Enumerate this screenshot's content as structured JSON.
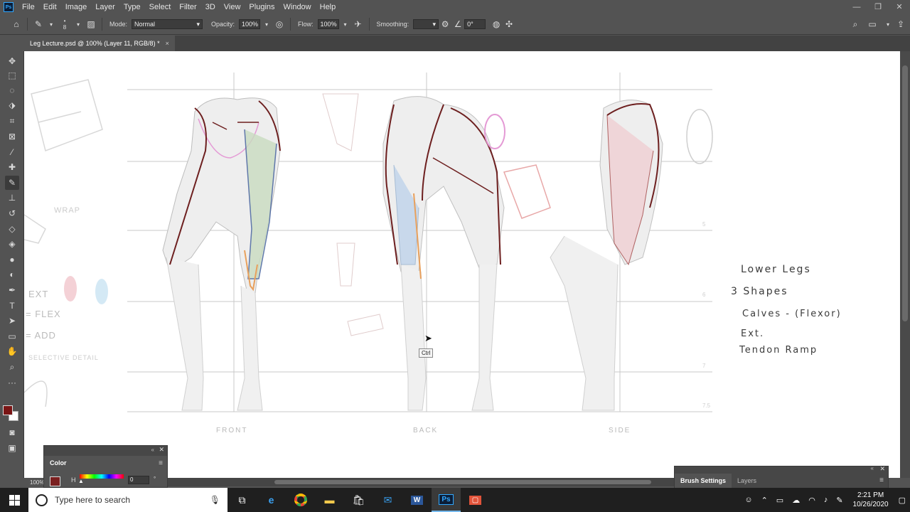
{
  "app": {
    "logo_text": "Ps",
    "menu": [
      "File",
      "Edit",
      "Image",
      "Layer",
      "Type",
      "Select",
      "Filter",
      "3D",
      "View",
      "Plugins",
      "Window",
      "Help"
    ]
  },
  "options_bar": {
    "brush_size": "8",
    "mode_label": "Mode:",
    "mode_value": "Normal",
    "opacity_label": "Opacity:",
    "opacity_value": "100%",
    "flow_label": "Flow:",
    "flow_value": "100%",
    "smoothing_label": "Smoothing:",
    "smoothing_value": "",
    "angle_value": "0°"
  },
  "document": {
    "tab_title": "Leg Lecture.psd @ 100% (Layer 11, RGB/8) *",
    "close_glyph": "×",
    "zoom_status": "100%"
  },
  "canvas": {
    "view_labels": [
      "FRONT",
      "BACK",
      "SIDE"
    ],
    "guide_numbers": [
      "5",
      "6",
      "7",
      "7.5"
    ],
    "left_notes": [
      "EXT",
      "= FLEX",
      "= ADD",
      "WRAP",
      "SELECTIVE DETAIL"
    ],
    "notes": [
      "Lower Legs",
      "3 Shapes",
      "Calves - (Flexor)",
      "Ext.",
      "Tendon Ramp"
    ],
    "tooltip": "Ctrl",
    "colors": {
      "flesh": "#8a2c2c",
      "stroke": "#6d1f1f",
      "grid": "#c8c8c8",
      "pink": "#e49ad5",
      "blue": "#b8d0ea",
      "green": "#a6cf98",
      "orange": "#e8a05c"
    }
  },
  "color_panel": {
    "title": "Color",
    "h_label": "H",
    "h_value": "0",
    "degree": "°",
    "swatch": "#7a1f1f"
  },
  "bottom_panel": {
    "tabs": [
      "Brush Settings",
      "Layers"
    ]
  },
  "taskbar": {
    "search_placeholder": "Type here to search",
    "time": "2:21 PM",
    "date": "10/26/2020"
  },
  "foreground_color": "#7a1515",
  "background_color": "#ffffff"
}
